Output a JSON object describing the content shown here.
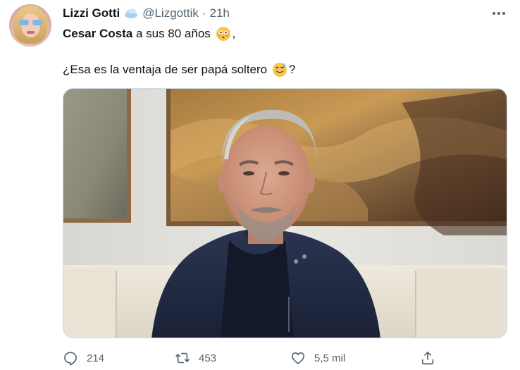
{
  "author": {
    "display_name": "Lizzi Gotti",
    "handle": "@Lizgottik",
    "separator": "·",
    "time": "21h",
    "name_badge_icon": "cloud-emoji-icon"
  },
  "tweet": {
    "mention": "Cesar Costa",
    "line1_text": " a sus 80 años ",
    "line1_emoji": "flushed-face-emoji",
    "line1_end": ",",
    "line2_text": "¿Esa es la ventaja de ser papá soltero ",
    "line2_emoji": "grinning-sweat-emoji",
    "line2_end": "?"
  },
  "media": {
    "subject": "photo-gray-haired-man-navy-jacket"
  },
  "actions": {
    "reply_count": "214",
    "retweet_count": "453",
    "like_count": "5,5 mil"
  },
  "colors": {
    "text_primary": "#0f1419",
    "text_secondary": "#536471",
    "border": "#cfd9de"
  }
}
